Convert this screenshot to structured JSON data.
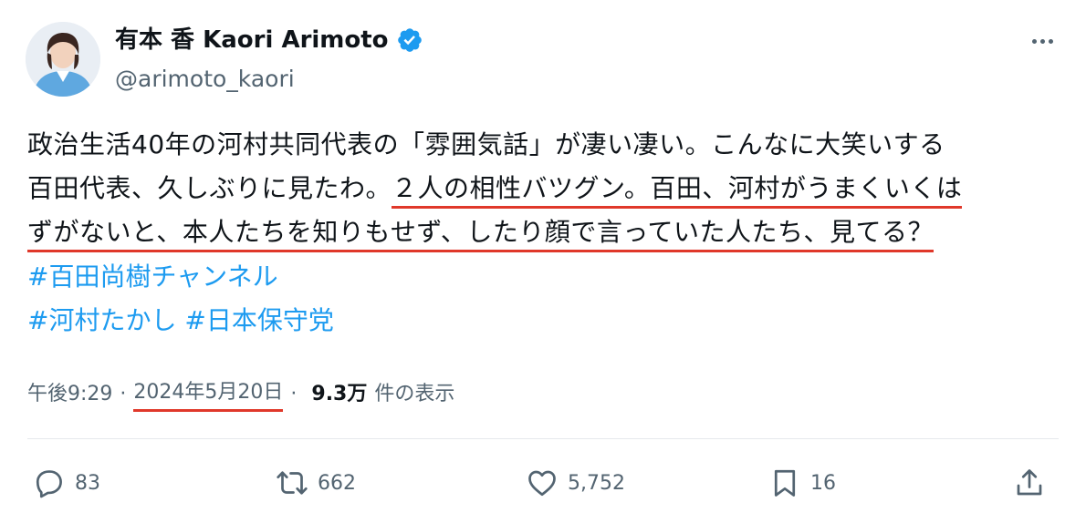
{
  "author": {
    "name": "有本 香 Kaori Arimoto",
    "handle": "@arimoto_kaori",
    "verified": true
  },
  "icons": {
    "more": "more-icon",
    "verified": "verified-badge-icon",
    "reply": "reply-icon",
    "retweet": "retweet-icon",
    "like": "like-icon",
    "bookmark": "bookmark-icon",
    "share": "share-icon"
  },
  "tweet": {
    "line1": "政治生活40年の河村共同代表の「雰囲気話」が凄い凄い。こんなに大笑いする",
    "line2_plain": "百田代表、久しぶりに見たわ。",
    "line2_underlined": "２人の相性バツグン。百田、河村がうまくいくは",
    "line3_underlined": "ずがないと、本人たちを知りもせず、したり顔で言っていた人たち、見てる？",
    "hashtags": [
      "#百田尚樹チャンネル",
      "#河村たかし",
      "#日本保守党"
    ]
  },
  "meta": {
    "time": "午後9:29",
    "separator": "·",
    "date": "2024年5月20日",
    "views": "9.3万",
    "views_label": "件の表示"
  },
  "actions": {
    "replies": "83",
    "retweets": "662",
    "likes": "5,752",
    "bookmarks": "16"
  },
  "colors": {
    "text": "#0f1419",
    "secondary": "#536471",
    "link": "#1d9bf0",
    "verified": "#1d9bf0",
    "underline": "#e0382a"
  }
}
